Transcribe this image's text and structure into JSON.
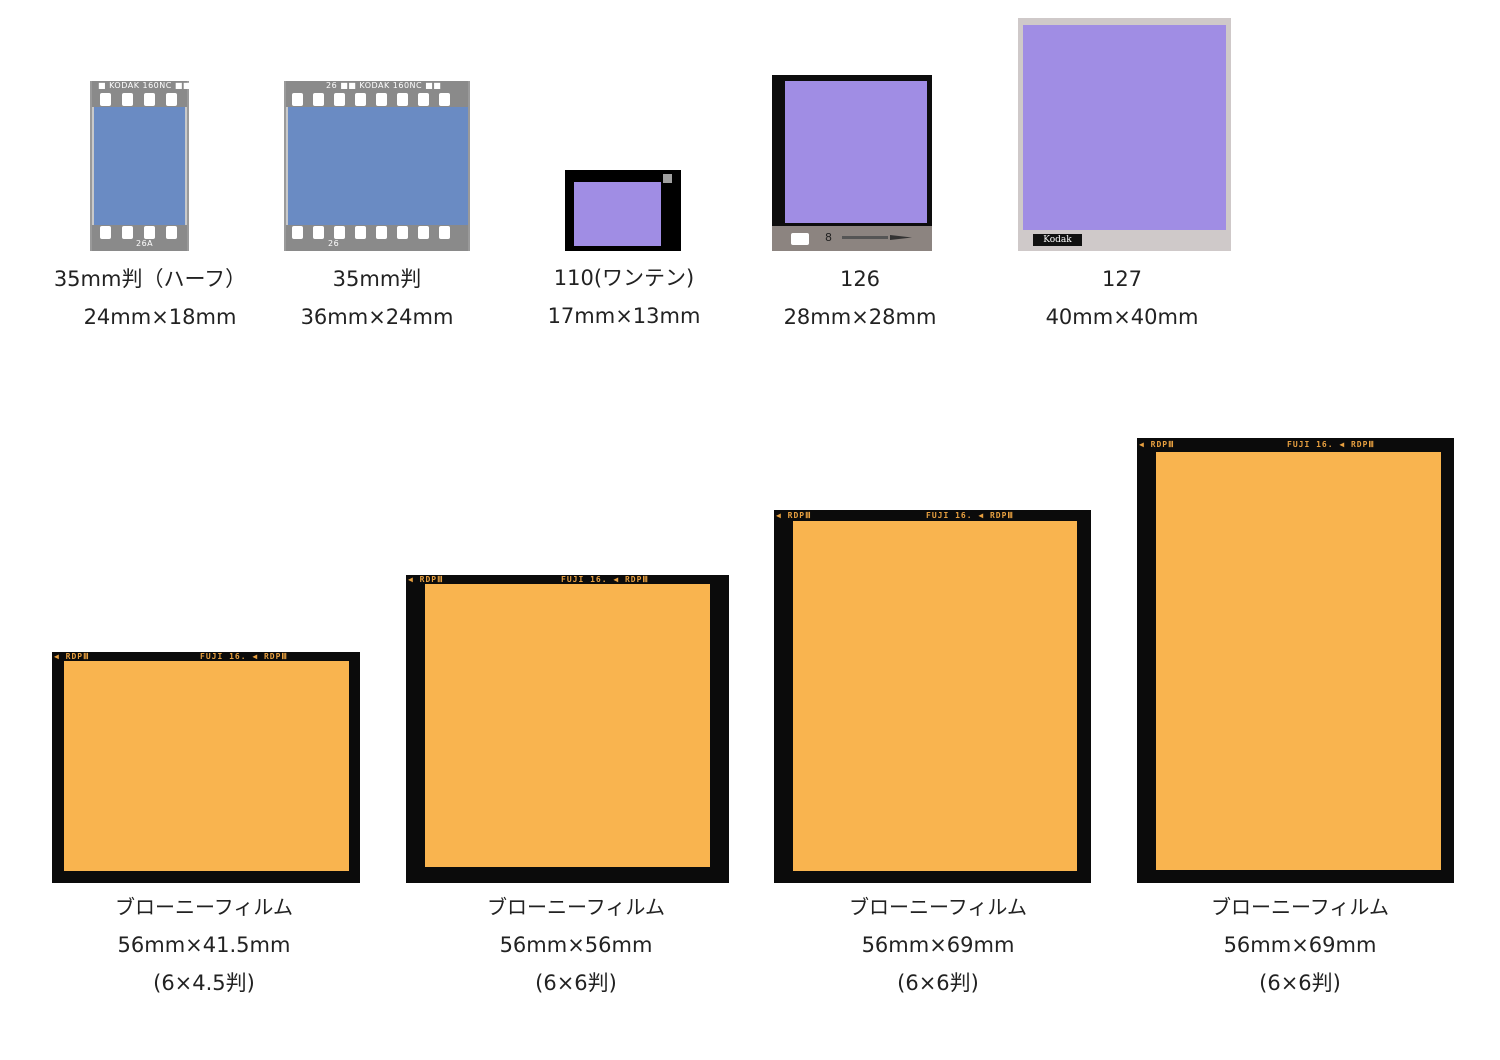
{
  "top_row": [
    {
      "name": "35mm判（ハーフ）",
      "size": "24mm×18mm"
    },
    {
      "name": "35mm判",
      "size": "36mm×24mm"
    },
    {
      "name": "110(ワンテン)",
      "size": "17mm×13mm"
    },
    {
      "name": "126",
      "size": "28mm×28mm"
    },
    {
      "name": "127",
      "size": "40mm×40mm"
    }
  ],
  "bottom_row": [
    {
      "name": "ブローニーフィルム",
      "size": "56mm×41.5mm",
      "format": "(6×4.5判)"
    },
    {
      "name": "ブローニーフィルム",
      "size": "56mm×56mm",
      "format": "(6×6判)"
    },
    {
      "name": "ブローニーフィルム",
      "size": "56mm×69mm",
      "format": "(6×6判)"
    },
    {
      "name": "ブローニーフィルム",
      "size": "56mm×69mm",
      "format": "(6×6判)"
    }
  ],
  "film_edge": {
    "kodak_top": "■ KODAK 160NC ■■",
    "kodak_top2": "26   ■■ KODAK 160NC ■■",
    "kodak_bottom": "26A",
    "kodak_bottom2": "26",
    "label_127": "Kodak",
    "label_126": "8",
    "fuji_left": "◀ RDPⅢ",
    "fuji_right": "FUJI  16. ◀  RDPⅢ"
  },
  "colors": {
    "film_35": "#6a8bc3",
    "film_small": "#a08de4",
    "film_brownie": "#f9b44f"
  }
}
